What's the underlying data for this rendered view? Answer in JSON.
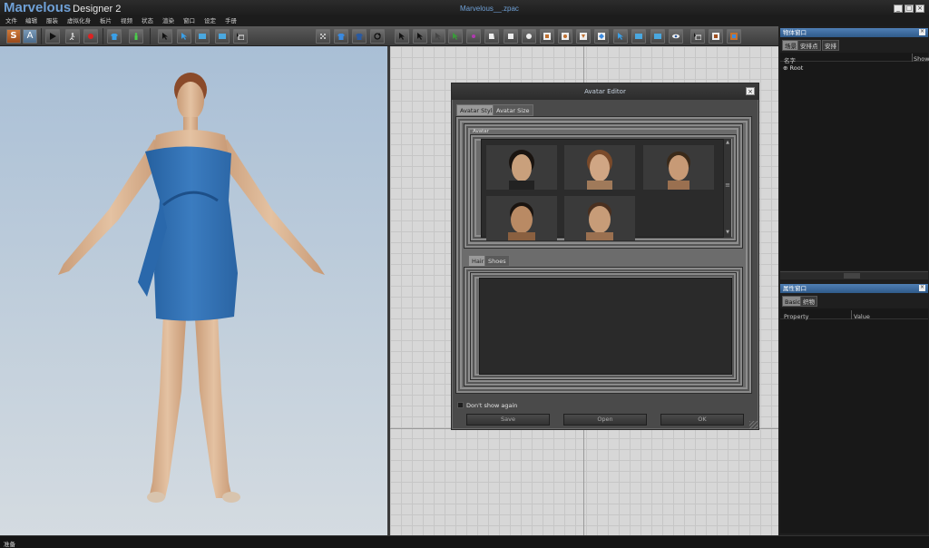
{
  "app": {
    "brand": "Marvelous",
    "product": "Designer 2",
    "document_title": "Marvelous__.zpac"
  },
  "window_controls": [
    "_",
    "□",
    "×"
  ],
  "menu": [
    "文件",
    "编辑",
    "服装",
    "虚拟化身",
    "板片",
    "视频",
    "状态",
    "渲染",
    "窗口",
    "设定",
    "手册"
  ],
  "toolbar_left": {
    "s_label": "S",
    "a_label": "A"
  },
  "avatar_editor": {
    "title": "Avatar Editor",
    "close": "×",
    "tabs": [
      "Avatar Style",
      "Avatar Size"
    ],
    "avatar_group_label": "Avatar",
    "sub_tabs": [
      "Hair",
      "Shoes"
    ],
    "dont_show_label": "Don't show again",
    "buttons": {
      "save": "Save",
      "open": "Open",
      "ok": "OK"
    },
    "scroll_up": "▲",
    "scroll_down": "▼",
    "scroll_grip": "≡"
  },
  "object_panel": {
    "title": "物体窗口",
    "close": "×",
    "tabs": [
      "场景",
      "安排点",
      "安排"
    ],
    "col_name": "名字",
    "col_show": "Show",
    "root_item": "Root",
    "root_glyph": "⊕"
  },
  "property_panel": {
    "title": "属性窗口",
    "close": "×",
    "tabs": [
      "Basic",
      "织物"
    ],
    "col_property": "Property",
    "col_value": "Value"
  },
  "status": {
    "text": "准备"
  },
  "colors": {
    "accent": "#6fa0d6",
    "panel_title": "#3f6fa3",
    "dress": "#2f6fb3",
    "skin": "#d9b291"
  }
}
